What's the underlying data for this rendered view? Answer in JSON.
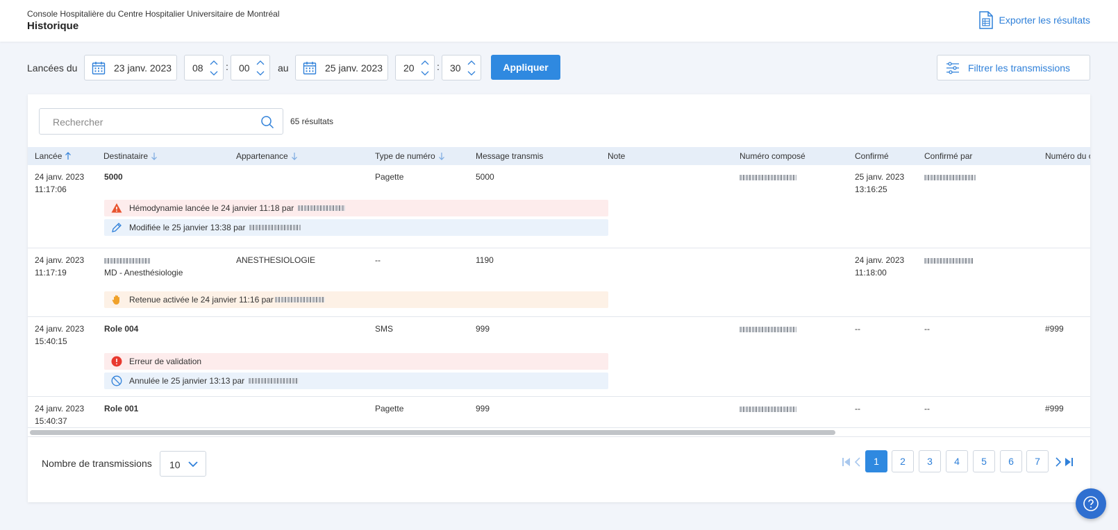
{
  "header": {
    "app_name": "Console Hospitalière du Centre Hospitalier Universitaire de Montréal",
    "title": "Historique",
    "export_label": "Exporter les résultats"
  },
  "filters": {
    "launched_from_label": "Lancées du",
    "start_date": "23 janv. 2023",
    "start_hour": "08",
    "start_minute": "00",
    "to_label": "au",
    "end_date": "25 janv. 2023",
    "end_hour": "20",
    "end_minute": "30",
    "time_separator": ":",
    "apply_label": "Appliquer",
    "filter_label": "Filtrer les transmissions"
  },
  "search": {
    "placeholder": "Rechercher",
    "results_count": "65 résultats"
  },
  "table": {
    "columns": [
      {
        "label": "Lancée",
        "sort": "asc"
      },
      {
        "label": "Destinataire",
        "sort": "desc"
      },
      {
        "label": "Appartenance",
        "sort": "desc"
      },
      {
        "label": "Type de numéro",
        "sort": "desc"
      },
      {
        "label": "Message transmis",
        "sort": ""
      },
      {
        "label": "Note",
        "sort": ""
      },
      {
        "label": "Numéro composé",
        "sort": ""
      },
      {
        "label": "Confirmé",
        "sort": ""
      },
      {
        "label": "Confirmé par",
        "sort": ""
      },
      {
        "label": "Numéro du c",
        "sort": ""
      }
    ],
    "rows": [
      {
        "launched_date": "24 janv. 2023",
        "launched_time": "11:17:06",
        "recipient": "5000",
        "recipient_sub": "",
        "affiliation": "",
        "number_type": "Pagette",
        "message": "5000",
        "confirmed_date": "25 janv. 2023",
        "confirmed_time": "13:16:25",
        "last_col": "",
        "alerts": [
          {
            "kind": "warning",
            "text": "Hémodynamie lancée le 24 janvier 11:18 par"
          },
          {
            "kind": "edit",
            "text": "Modifiée le 25 janvier 13:38 par"
          }
        ]
      },
      {
        "launched_date": "24 janv. 2023",
        "launched_time": "11:17:19",
        "recipient": "",
        "recipient_sub": "MD - Anesthésiologie",
        "affiliation": "ANESTHESIOLOGIE",
        "number_type": "--",
        "message": "1190",
        "confirmed_date": "24 janv. 2023",
        "confirmed_time": "11:18:00",
        "last_col": "",
        "alerts": [
          {
            "kind": "hold",
            "text": "Retenue activée le 24 janvier 11:16 par"
          }
        ]
      },
      {
        "launched_date": "24 janv. 2023",
        "launched_time": "15:40:15",
        "recipient": "Role 004",
        "recipient_sub": "",
        "affiliation": "",
        "number_type": "SMS",
        "message": "999",
        "confirmed_date": "--",
        "confirmed_time": "",
        "confirmed_by": "--",
        "last_col": "#999",
        "alerts": [
          {
            "kind": "error",
            "text": "Erreur de validation"
          },
          {
            "kind": "cancel",
            "text": "Annulée le 25 janvier 13:13 par"
          }
        ]
      },
      {
        "launched_date": "24 janv. 2023",
        "launched_time": "15:40:37",
        "recipient": "Role 001",
        "recipient_sub": "",
        "affiliation": "",
        "number_type": "Pagette",
        "message": "999",
        "confirmed_date": "--",
        "confirmed_time": "",
        "confirmed_by": "--",
        "last_col": "#999",
        "alerts": []
      }
    ]
  },
  "footer": {
    "page_size_label": "Nombre de transmissions",
    "page_size": "10",
    "pages": [
      "1",
      "2",
      "3",
      "4",
      "5",
      "6",
      "7"
    ],
    "current_page": "1"
  },
  "icons": {
    "export": "document-list-icon",
    "calendar": "calendar-icon",
    "filter": "sliders-icon",
    "search": "search-icon",
    "help": "question-icon"
  },
  "colors": {
    "accent": "#2f89e0",
    "link": "#2f80d9",
    "header_row": "#e6eef8",
    "alert_red": "#fdecec",
    "alert_blue": "#eaf2fb",
    "alert_orange": "#fdf1e6"
  }
}
